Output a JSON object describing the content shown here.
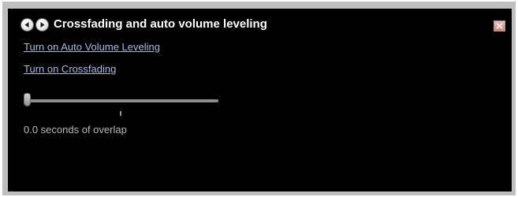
{
  "window": {
    "title": "Crossfading and auto volume leveling"
  },
  "links": {
    "auto_volume": "Turn on Auto Volume Leveling",
    "crossfading": "Turn on Crossfading"
  },
  "slider": {
    "value_fraction": 0.0
  },
  "status": {
    "overlap_text": "0.0 seconds of overlap"
  },
  "icons": {
    "back": "arrow-left-icon",
    "forward": "arrow-right-icon",
    "close": "close-icon"
  },
  "colors": {
    "panel_background": "#000000",
    "link": "#9bbcf0",
    "title_text": "#ffffff",
    "close_button": "#d9826b"
  }
}
